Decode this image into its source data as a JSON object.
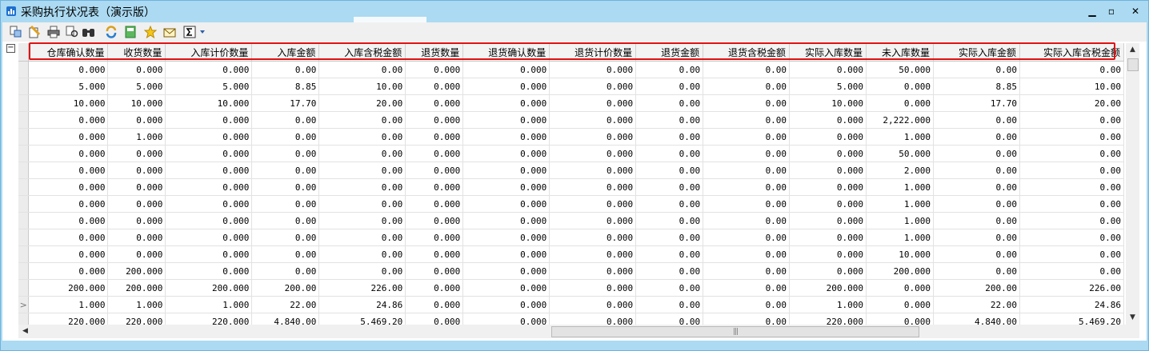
{
  "window": {
    "title": "采购执行状况表（演示版）",
    "minimize_glyph": "▁",
    "restore_glyph": "▫",
    "close_glyph": "✕"
  },
  "toolbar": {
    "items": [
      {
        "icon": "preview-icon"
      },
      {
        "icon": "page-setup-icon"
      },
      {
        "icon": "print-icon"
      },
      {
        "icon": "filter-icon"
      },
      {
        "icon": "find-icon"
      },
      {
        "icon": "refresh-icon"
      },
      {
        "icon": "export-icon"
      },
      {
        "icon": "favorite-icon"
      },
      {
        "icon": "mail-icon"
      },
      {
        "icon": "sum-icon"
      },
      {
        "icon": "dropdown-arrow-icon"
      }
    ]
  },
  "colors": {
    "title_bar": "#abdaf2",
    "highlight": "#e01010",
    "header_bg": "#f3f3f3"
  },
  "grid": {
    "collapse_glyph": "−",
    "columns": [
      "仓库确认数量",
      "收货数量",
      "入库计价数量",
      "入库金额",
      "入库含税金额",
      "退货数量",
      "退货确认数量",
      "退货计价数量",
      "退货金额",
      "退货含税金额",
      "实际入库数量",
      "未入库数量",
      "实际入库金额",
      "实际入库含税金额"
    ],
    "current_row_marker": ">",
    "rows": [
      [
        "0.000",
        "0.000",
        "0.000",
        "0.00",
        "0.00",
        "0.000",
        "0.000",
        "0.000",
        "0.00",
        "0.00",
        "0.000",
        "50.000",
        "0.00",
        "0.00"
      ],
      [
        "5.000",
        "5.000",
        "5.000",
        "8.85",
        "10.00",
        "0.000",
        "0.000",
        "0.000",
        "0.00",
        "0.00",
        "5.000",
        "0.000",
        "8.85",
        "10.00"
      ],
      [
        "10.000",
        "10.000",
        "10.000",
        "17.70",
        "20.00",
        "0.000",
        "0.000",
        "0.000",
        "0.00",
        "0.00",
        "10.000",
        "0.000",
        "17.70",
        "20.00"
      ],
      [
        "0.000",
        "0.000",
        "0.000",
        "0.00",
        "0.00",
        "0.000",
        "0.000",
        "0.000",
        "0.00",
        "0.00",
        "0.000",
        "2,222.000",
        "0.00",
        "0.00"
      ],
      [
        "0.000",
        "1.000",
        "0.000",
        "0.00",
        "0.00",
        "0.000",
        "0.000",
        "0.000",
        "0.00",
        "0.00",
        "0.000",
        "1.000",
        "0.00",
        "0.00"
      ],
      [
        "0.000",
        "0.000",
        "0.000",
        "0.00",
        "0.00",
        "0.000",
        "0.000",
        "0.000",
        "0.00",
        "0.00",
        "0.000",
        "50.000",
        "0.00",
        "0.00"
      ],
      [
        "0.000",
        "0.000",
        "0.000",
        "0.00",
        "0.00",
        "0.000",
        "0.000",
        "0.000",
        "0.00",
        "0.00",
        "0.000",
        "2.000",
        "0.00",
        "0.00"
      ],
      [
        "0.000",
        "0.000",
        "0.000",
        "0.00",
        "0.00",
        "0.000",
        "0.000",
        "0.000",
        "0.00",
        "0.00",
        "0.000",
        "1.000",
        "0.00",
        "0.00"
      ],
      [
        "0.000",
        "0.000",
        "0.000",
        "0.00",
        "0.00",
        "0.000",
        "0.000",
        "0.000",
        "0.00",
        "0.00",
        "0.000",
        "1.000",
        "0.00",
        "0.00"
      ],
      [
        "0.000",
        "0.000",
        "0.000",
        "0.00",
        "0.00",
        "0.000",
        "0.000",
        "0.000",
        "0.00",
        "0.00",
        "0.000",
        "1.000",
        "0.00",
        "0.00"
      ],
      [
        "0.000",
        "0.000",
        "0.000",
        "0.00",
        "0.00",
        "0.000",
        "0.000",
        "0.000",
        "0.00",
        "0.00",
        "0.000",
        "1.000",
        "0.00",
        "0.00"
      ],
      [
        "0.000",
        "0.000",
        "0.000",
        "0.00",
        "0.00",
        "0.000",
        "0.000",
        "0.000",
        "0.00",
        "0.00",
        "0.000",
        "10.000",
        "0.00",
        "0.00"
      ],
      [
        "0.000",
        "200.000",
        "0.000",
        "0.00",
        "0.00",
        "0.000",
        "0.000",
        "0.000",
        "0.00",
        "0.00",
        "0.000",
        "200.000",
        "0.00",
        "0.00"
      ],
      [
        "200.000",
        "200.000",
        "200.000",
        "200.00",
        "226.00",
        "0.000",
        "0.000",
        "0.000",
        "0.00",
        "0.00",
        "200.000",
        "0.000",
        "200.00",
        "226.00"
      ],
      [
        "1.000",
        "1.000",
        "1.000",
        "22.00",
        "24.86",
        "0.000",
        "0.000",
        "0.000",
        "0.00",
        "0.00",
        "1.000",
        "0.000",
        "22.00",
        "24.86"
      ],
      [
        "220.000",
        "220.000",
        "220.000",
        "4,840.00",
        "5,469.20",
        "0.000",
        "0.000",
        "0.000",
        "0.00",
        "0.00",
        "220.000",
        "0.000",
        "4,840.00",
        "5,469.20"
      ]
    ],
    "current_row_index": 14
  },
  "scrollbars": {
    "up_glyph": "▲",
    "down_glyph": "▼",
    "left_glyph": "◀",
    "right_glyph": "▶",
    "grip_glyph": "|||"
  }
}
